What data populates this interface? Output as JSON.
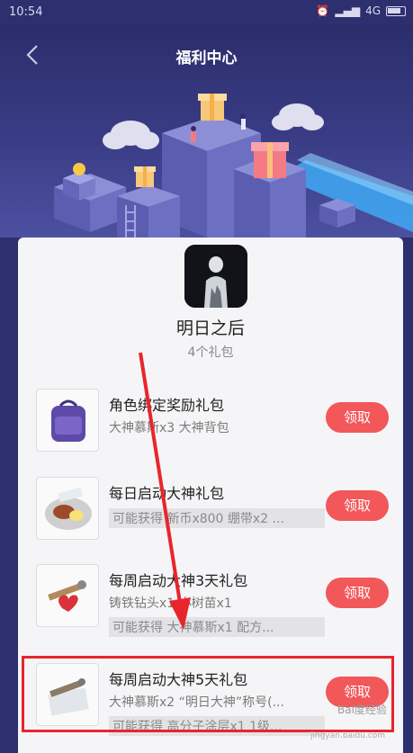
{
  "status_bar": {
    "time": "10:54",
    "network": "4G",
    "alarm_icon": "alarm-icon",
    "signal_icon": "signal-icon",
    "battery_icon": "battery-icon"
  },
  "header": {
    "title": "福利中心",
    "back_icon": "chevron-left-icon"
  },
  "app": {
    "name": "明日之后",
    "gift_count": "4个礼包"
  },
  "gifts": [
    {
      "title": "角色绑定奖励礼包",
      "desc": "大神慕斯x3 大神背包",
      "desc2": "",
      "button": "领取"
    },
    {
      "title": "每日启动大神礼包",
      "desc": "",
      "desc2": "可能获得 新币x800 绷带x2 ...",
      "button": "领取"
    },
    {
      "title": "每周启动大神3天礼包",
      "desc": "铸铁钻头x1 小树苗x1",
      "desc2": "可能获得 大神慕斯x1 配方...",
      "button": "领取"
    },
    {
      "title": "每周启动大神5天礼包",
      "desc": "大神慕斯x2 “明日大神”称号(...",
      "desc2": "可能获得 高分子涂层x1 1级...",
      "button": "领取"
    }
  ],
  "watermark": {
    "brand": "Bai度经验",
    "url": "jingyan.baidu.com"
  },
  "colors": {
    "header_bg": "#2d2f6e",
    "claim_button": "#f2575a",
    "annotation": "#e8252d"
  }
}
